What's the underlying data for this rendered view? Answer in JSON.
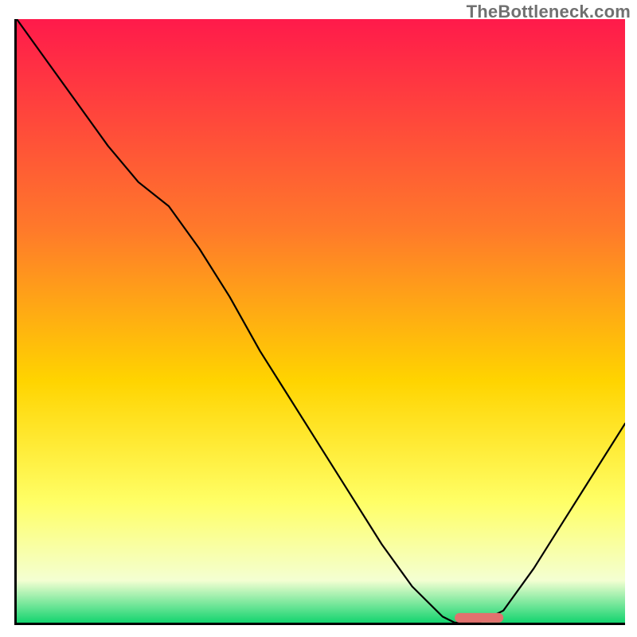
{
  "watermark": "TheBottleneck.com",
  "colors": {
    "gradient_top": "#ff1a4b",
    "gradient_mid_upper": "#ff7a2a",
    "gradient_mid": "#ffd400",
    "gradient_mid_lower": "#ffff66",
    "gradient_low": "#f4ffd2",
    "gradient_bottom": "#14d46f",
    "marker": "#e2716e",
    "curve": "#000000",
    "axis": "#000000"
  },
  "chart_data": {
    "type": "line",
    "title": "",
    "xlabel": "",
    "ylabel": "",
    "xlim": [
      0,
      100
    ],
    "ylim": [
      0,
      100
    ],
    "series": [
      {
        "name": "bottleneck-curve",
        "x": [
          0,
          5,
          10,
          15,
          20,
          25,
          30,
          35,
          40,
          45,
          50,
          55,
          60,
          65,
          70,
          72,
          76,
          80,
          85,
          90,
          95,
          100
        ],
        "y": [
          100,
          93,
          86,
          79,
          73,
          69,
          62,
          54,
          45,
          37,
          29,
          21,
          13,
          6,
          1,
          0,
          0,
          2,
          9,
          17,
          25,
          33
        ]
      }
    ],
    "marker": {
      "name": "optimal-range",
      "x_start": 72,
      "x_end": 80,
      "y": 0.8,
      "shape": "rounded-bar",
      "color": "#e2716e"
    },
    "background": {
      "type": "vertical-gradient",
      "stops": [
        {
          "pos": 0.0,
          "color": "#ff1a4b"
        },
        {
          "pos": 0.35,
          "color": "#ff7a2a"
        },
        {
          "pos": 0.6,
          "color": "#ffd400"
        },
        {
          "pos": 0.8,
          "color": "#ffff66"
        },
        {
          "pos": 0.93,
          "color": "#f4ffd2"
        },
        {
          "pos": 1.0,
          "color": "#14d46f"
        }
      ]
    }
  }
}
